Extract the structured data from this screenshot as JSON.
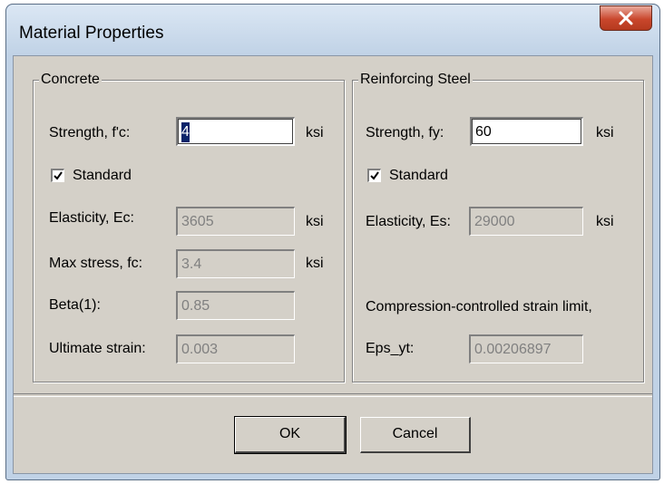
{
  "window": {
    "title": "Material Properties"
  },
  "concrete": {
    "group_label": "Concrete",
    "strength_label": "Strength, f'c:",
    "strength_value": "4",
    "strength_unit": "ksi",
    "standard_label": "Standard",
    "standard_checked": true,
    "elasticity_label": "Elasticity, Ec:",
    "elasticity_value": "3605",
    "elasticity_unit": "ksi",
    "maxstress_label": "Max stress, fc:",
    "maxstress_value": "3.4",
    "maxstress_unit": "ksi",
    "beta_label": "Beta(1):",
    "beta_value": "0.85",
    "ultimate_label": "Ultimate strain:",
    "ultimate_value": "0.003"
  },
  "steel": {
    "group_label": "Reinforcing Steel",
    "strength_label": "Strength, fy:",
    "strength_value": "60",
    "strength_unit": "ksi",
    "standard_label": "Standard",
    "standard_checked": true,
    "elasticity_label": "Elasticity, Es:",
    "elasticity_value": "29000",
    "elasticity_unit": "ksi",
    "compression_label": "Compression-controlled strain limit,",
    "eps_label": "Eps_yt:",
    "eps_value": "0.00206897"
  },
  "buttons": {
    "ok_label": "OK",
    "cancel_label": "Cancel"
  },
  "icons": {
    "close": "close-x-icon",
    "check": "checkmark-icon"
  }
}
